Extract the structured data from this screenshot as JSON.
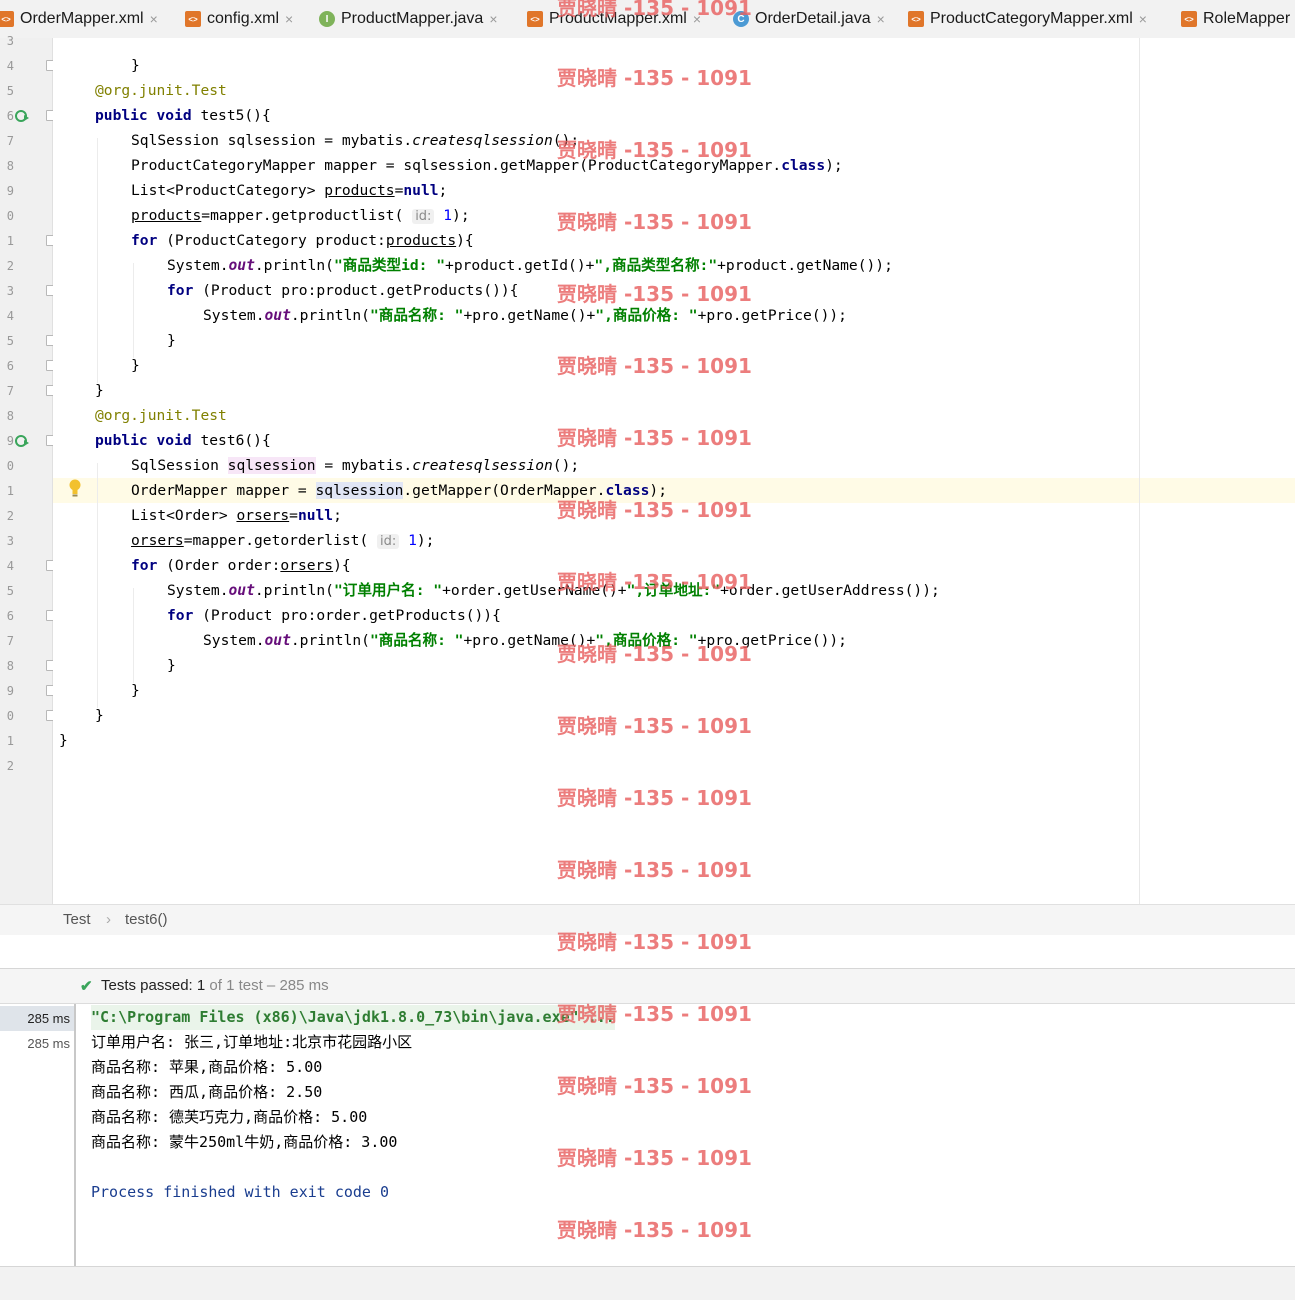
{
  "tabs": [
    {
      "label": "OrderMapper.xml",
      "icon": "xml-file-icon",
      "closable": true
    },
    {
      "label": "config.xml",
      "icon": "xml-file-icon",
      "closable": true
    },
    {
      "label": "ProductMapper.java",
      "icon": "interface-icon",
      "icon_glyph": "I",
      "closable": true
    },
    {
      "label": "ProductMapper.xml",
      "icon": "xml-file-icon",
      "closable": true
    },
    {
      "label": "OrderDetail.java",
      "icon": "class-icon",
      "icon_glyph": "C",
      "closable": true
    },
    {
      "label": "ProductCategoryMapper.xml",
      "icon": "xml-file-icon",
      "closable": true
    },
    {
      "label": "RoleMapper",
      "icon": "xml-file-icon",
      "closable": false
    }
  ],
  "tab_close_glyph": "×",
  "xml_icon_glyph": "<>",
  "line_numbers": [
    "3",
    "4",
    "5",
    "6",
    "7",
    "8",
    "9",
    "0",
    "1",
    "2",
    "3",
    "4",
    "5",
    "6",
    "7",
    "8",
    "9",
    "0",
    "1",
    "2",
    "3",
    "4",
    "5",
    "6",
    "7",
    "8",
    "9",
    "0",
    "1",
    "2"
  ],
  "code": {
    "l1": "}",
    "l2_ann": "@org.junit.",
    "l2_test": "Test",
    "l3_public": "public",
    "l3_void": "void",
    "l3_sig": " test5(){",
    "l4_a": "SqlSession sqlsession = mybatis.",
    "l4_method": "createsqlsession",
    "l4_b": "();",
    "l5_a": "ProductCategoryMapper mapper = sqlsession.getMapper(ProductCategoryMapper.",
    "l5_class": "class",
    "l5_b": ");",
    "l6_a": "List<ProductCategory> ",
    "l6_var": "products",
    "l6_eq": "=",
    "l6_null": "null",
    "l6_b": ";",
    "l7_var": "products",
    "l7_a": "=mapper.getproductlist(",
    "l7_hint": "id:",
    "l7_num": "1",
    "l7_b": ");",
    "l8_for": "for",
    "l8_a": " (ProductCategory product:",
    "l8_var": "products",
    "l8_b": "){",
    "l9_a": "System.",
    "l9_out": "out",
    "l9_b": ".println(",
    "l9_s1": "\"商品类型id: \"",
    "l9_c": "+product.getId()+",
    "l9_s2": "\",商品类型名称:\"",
    "l9_d": "+product.getName());",
    "l10_for": "for",
    "l10_a": " (Product pro:product.getProducts()){",
    "l11_a": "System.",
    "l11_out": "out",
    "l11_b": ".println(",
    "l11_s1": "\"商品名称: \"",
    "l11_c": "+pro.getName()+",
    "l11_s2": "\",商品价格: \"",
    "l11_d": "+pro.getPrice());",
    "l12": "}",
    "l13": "}",
    "l14": "}",
    "l15_ann": "@org.junit.",
    "l15_test": "Test",
    "l16_public": "public",
    "l16_void": "void",
    "l16_sig": " test6(){",
    "l17_a": "SqlSession ",
    "l17_var": "sqlsession",
    "l17_b": " = mybatis.",
    "l17_method": "createsqlsession",
    "l17_c": "();",
    "l18_a": "OrderMapper mapper = ",
    "l18_var": "sqlsession",
    "l18_b": ".getMapper(OrderMapper.",
    "l18_class": "class",
    "l18_c": ");",
    "l19_a": "List<Order> ",
    "l19_var": "orsers",
    "l19_eq": "=",
    "l19_null": "null",
    "l19_b": ";",
    "l20_var": "orsers",
    "l20_a": "=mapper.getorderlist(",
    "l20_hint": "id:",
    "l20_num": "1",
    "l20_b": ");",
    "l21_for": "for",
    "l21_a": " (Order order:",
    "l21_var": "orsers",
    "l21_b": "){",
    "l22_a": "System.",
    "l22_out": "out",
    "l22_b": ".println(",
    "l22_s1": "\"订单用户名: \"",
    "l22_c": "+order.getUserName()+",
    "l22_s2": "\",订单地址:\"",
    "l22_d": "+order.getUserAddress());",
    "l23_for": "for",
    "l23_a": " (Product pro:order.getProducts()){",
    "l24_a": "System.",
    "l24_out": "out",
    "l24_b": ".println(",
    "l24_s1": "\"商品名称: \"",
    "l24_c": "+pro.getName()+",
    "l24_s2": "\",商品价格: \"",
    "l24_d": "+pro.getPrice());",
    "l25": "}",
    "l26": "}",
    "l27": "}",
    "l28": "}"
  },
  "breadcrumb": {
    "items": [
      "Test",
      "test6()"
    ],
    "separator": "›"
  },
  "test_status": {
    "check_glyph": "✔",
    "label": "Tests passed: ",
    "passed": "1",
    "rest": " of 1 test – 285 ms"
  },
  "test_tree": [
    "285 ms",
    "285 ms"
  ],
  "console": {
    "command": "\"C:\\Program Files (x86)\\Java\\jdk1.8.0_73\\bin\\java.exe\" ...",
    "lines": [
      "订单用户名: 张三,订单地址:北京市花园路小区",
      "商品名称: 苹果,商品价格: 5.00",
      "商品名称: 西瓜,商品价格: 2.50",
      "商品名称: 德芙巧克力,商品价格: 5.00",
      "商品名称: 蒙牛250ml牛奶,商品价格: 3.00"
    ],
    "exit": "Process finished with exit code 0"
  },
  "watermark": "贾晓晴 -135 - 1091",
  "colors": {
    "keyword": "#000080",
    "string": "#008000",
    "annotation": "#808000",
    "field": "#660e7a",
    "watermark": "#e86060",
    "pass": "#3aa55b"
  }
}
